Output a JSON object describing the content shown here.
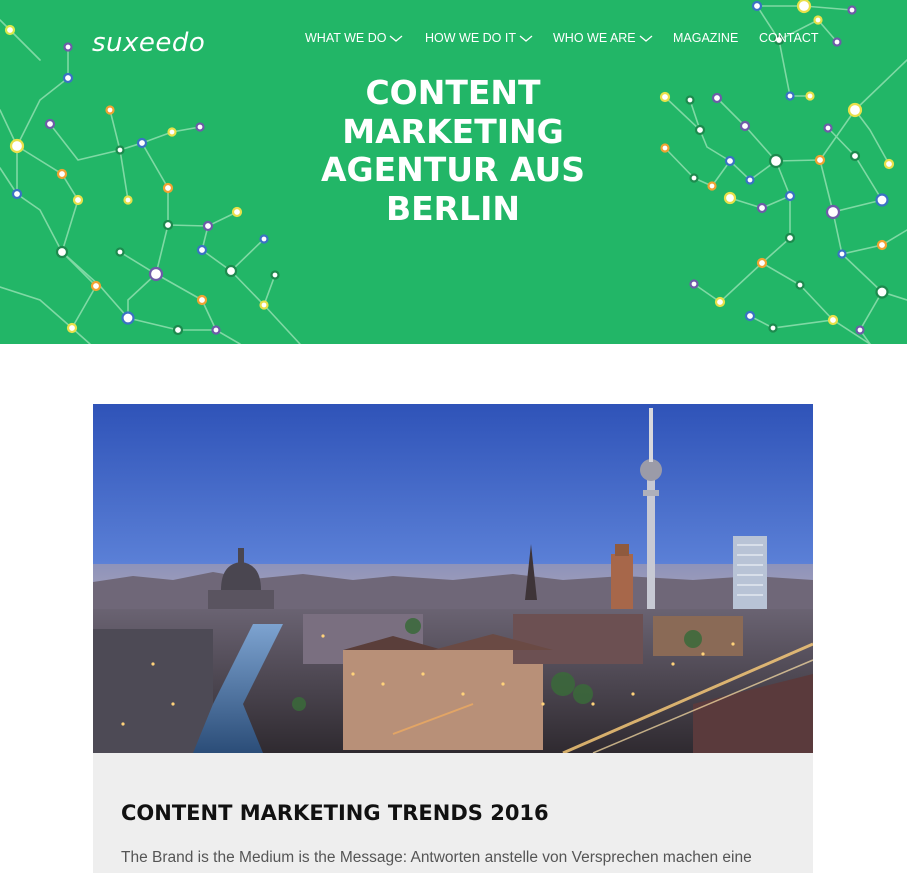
{
  "brand": {
    "logo_text": "suxeedo",
    "color_primary": "#22b667"
  },
  "nav": {
    "items": [
      {
        "label": "WHAT WE DO",
        "has_dropdown": true
      },
      {
        "label": "HOW WE DO IT",
        "has_dropdown": true
      },
      {
        "label": "WHO WE ARE",
        "has_dropdown": true
      },
      {
        "label": "MAGAZINE",
        "has_dropdown": false
      },
      {
        "label": "CONTACT",
        "has_dropdown": false
      }
    ],
    "dropdown_icon": "chevron-down-icon"
  },
  "hero": {
    "title_lines": [
      "CONTENT",
      "MARKETING",
      "AGENTUR AUS",
      "BERLIN"
    ],
    "background": "network-pattern"
  },
  "post": {
    "image_alt": "Berlin skyline at dusk with TV tower",
    "title": "CONTENT MARKETING TRENDS 2016",
    "excerpt": "The Brand is the Medium is the Message: Antworten anstelle von Versprechen machen eine"
  }
}
